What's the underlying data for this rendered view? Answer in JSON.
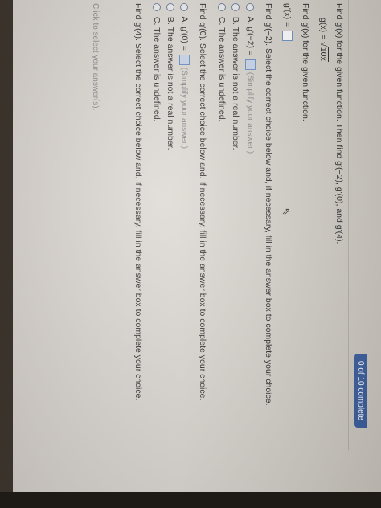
{
  "status": "0 of 10 complete",
  "question": {
    "prompt": "Find g'(x) for the given function. Then find g'(−2), g'(0), and g'(4).",
    "function_lhs": "g(x) =",
    "function_radicand": "10x",
    "find_derivative": "Find g'(x) for the given function.",
    "derivative_lhs": "g'(x) ="
  },
  "part_neg2": {
    "instruction": "Find g'(−2). Select the correct choice below and, if necessary, fill in the answer box to complete your choice.",
    "option_a_prefix": "A.",
    "option_a_text": "g'(−2) =",
    "option_a_hint": "(Simplify your answer.)",
    "option_b": "B.  The answer is not a real number.",
    "option_c": "C.  The answer is undefined."
  },
  "part_0": {
    "instruction": "Find g'(0). Select the correct choice below and, if necessary, fill in the answer box to complete your choice.",
    "option_a_prefix": "A.",
    "option_a_text": "g'(0) =",
    "option_a_hint": "(Simplify your answer.)",
    "option_b": "B.  The answer is not a real number.",
    "option_c": "C.  The answer is undefined."
  },
  "part_4": {
    "instruction": "Find g'(4). Select the correct choice below and, if necessary, fill in the answer box to complete your choice."
  },
  "footer_hint": "Click to select your answer(s)."
}
